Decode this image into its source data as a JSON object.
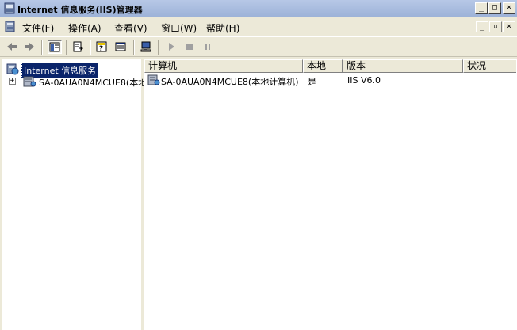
{
  "window": {
    "title": "Internet 信息服务(IIS)管理器",
    "minimize_glyph": "_",
    "maximize_glyph": "□",
    "close_glyph": "×"
  },
  "menu": {
    "items": [
      {
        "label": "文件(F)"
      },
      {
        "label": "操作(A)"
      },
      {
        "label": "查看(V)"
      },
      {
        "label": "窗口(W)"
      },
      {
        "label": "帮助(H)"
      }
    ],
    "mdi_minimize": "_",
    "mdi_restore": "▫",
    "mdi_close": "×"
  },
  "toolbar": {
    "icons": [
      "back-arrow-icon",
      "forward-arrow-icon",
      "show-tree-icon",
      "export-list-icon",
      "help-icon",
      "properties-icon",
      "connect-computer-icon",
      "start-icon",
      "stop-icon",
      "pause-icon"
    ]
  },
  "tree": {
    "root_label": "Internet 信息服务",
    "expander": "+",
    "child_label": "SA-0AUA0N4MCUE8(本地计"
  },
  "list": {
    "columns": [
      "计算机",
      "本地",
      "版本",
      "状况"
    ],
    "rows": [
      {
        "computer": "SA-0AUA0N4MCUE8(本地计算机)",
        "local": "是",
        "version": "IIS V6.0",
        "status": ""
      }
    ]
  },
  "colors": {
    "selection": "#0a246a",
    "chrome": "#ece9d8",
    "titlebar": "#9db3d8"
  }
}
